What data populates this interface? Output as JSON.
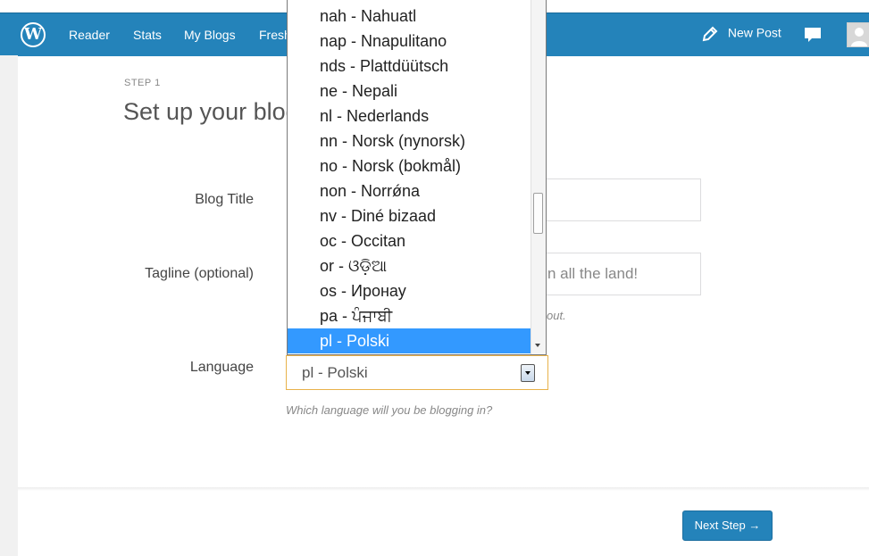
{
  "topbar": {
    "logo": "W",
    "nav": [
      "Reader",
      "Stats",
      "My Blogs",
      "Fresh"
    ],
    "new_post": "New Post"
  },
  "page": {
    "step": "STEP 1",
    "title": "Set up your blog"
  },
  "form": {
    "blog_title_label": "Blog Title",
    "blog_title_value": "",
    "tagline_label": "Tagline (optional)",
    "tagline_visible_value": "n all the land!",
    "tagline_hint_visible": "out.",
    "language_label": "Language",
    "language_value": "pl - Polski",
    "language_hint": "Which language will you be blogging in?"
  },
  "dropdown": {
    "items": [
      "nah - Nahuatl",
      "nap - Nnapulitano",
      "nds - Plattdüütsch",
      "ne - Nepali",
      "nl - Nederlands",
      "nn - Norsk (nynorsk)",
      "no - Norsk (bokmål)",
      "non - Norrǿna",
      "nv - Diné bizaad",
      "oc - Occitan",
      "or - ଓଡ଼ିଆ",
      "os - Иронау",
      "pa - ਪੰਜਾਬੀ",
      "pl - Polski"
    ],
    "selected": "pl - Polski"
  },
  "footer": {
    "next_label": "Next Step →"
  },
  "colors": {
    "brand": "#2483ba",
    "selection": "#3399ff",
    "focus_border": "#e8b24a"
  }
}
